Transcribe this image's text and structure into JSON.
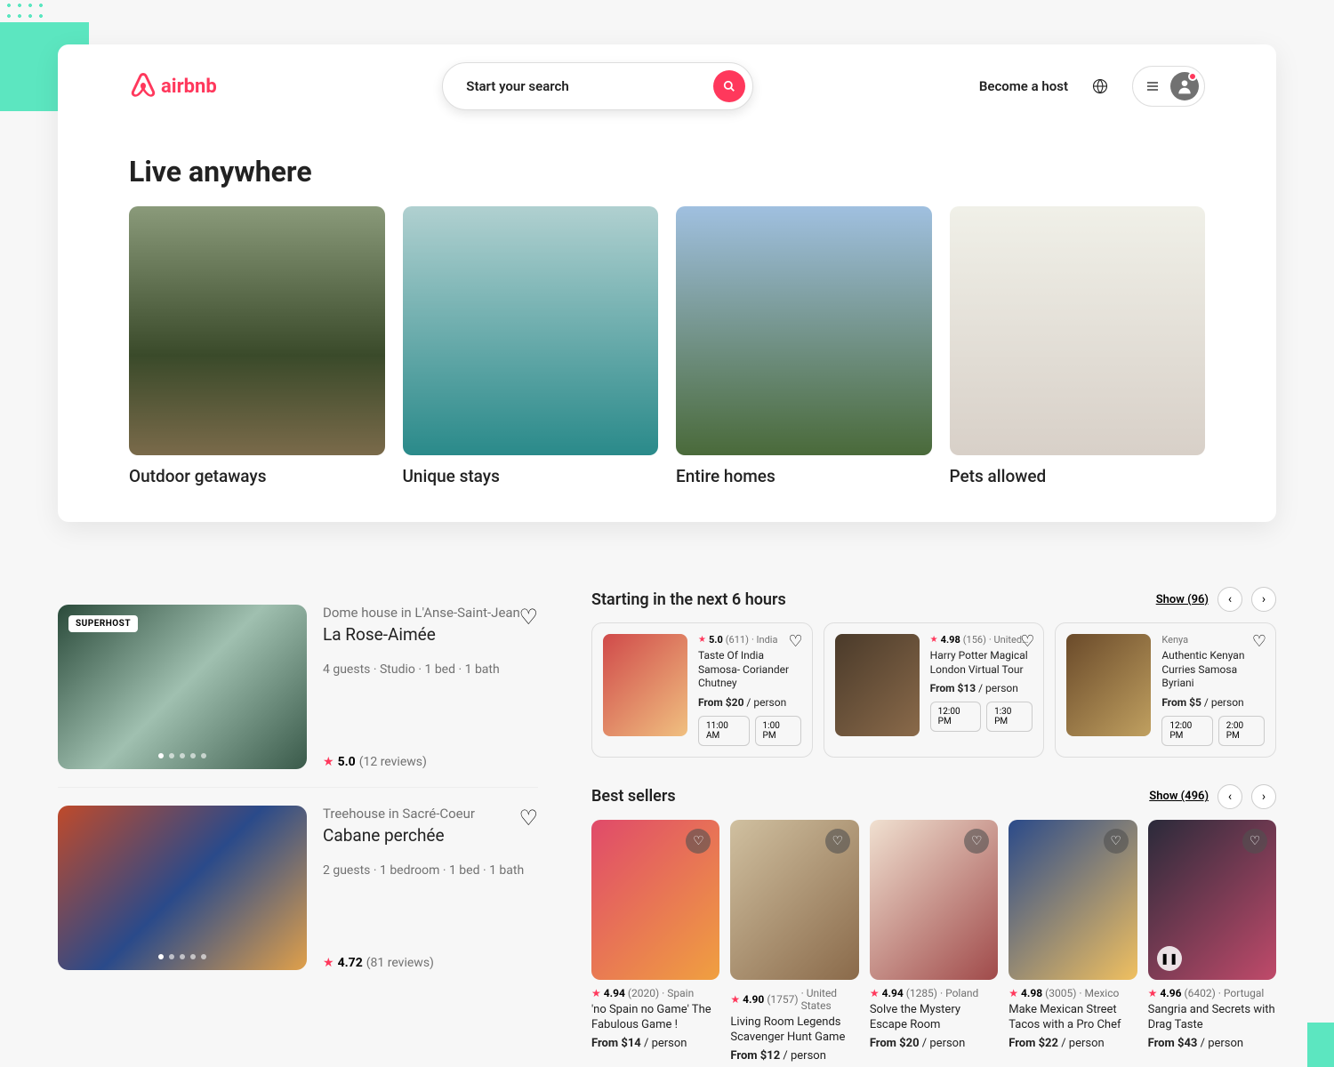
{
  "header": {
    "brand": "airbnb",
    "search_placeholder": "Start your search",
    "host_link": "Become a host"
  },
  "live_anywhere": {
    "title": "Live anywhere",
    "cards": [
      {
        "label": "Outdoor getaways"
      },
      {
        "label": "Unique stays"
      },
      {
        "label": "Entire homes"
      },
      {
        "label": "Pets allowed"
      }
    ]
  },
  "stays": [
    {
      "badge": "SUPERHOST",
      "subtitle": "Dome house in L'Anse-Saint-Jean",
      "title": "La Rose-Aimée",
      "meta": "4 guests · Studio · 1 bed · 1 bath",
      "rating": "5.0",
      "reviews": "(12 reviews)"
    },
    {
      "subtitle": "Treehouse in Sacré-Coeur",
      "title": "Cabane perchée",
      "meta": "2 guests · 1 bedroom · 1 bed · 1 bath",
      "rating": "4.72",
      "reviews": "(81 reviews)"
    }
  ],
  "starting": {
    "heading": "Starting in the next 6 hours",
    "show": "Show (96)",
    "items": [
      {
        "rating": "5.0",
        "count": "(611)",
        "loc": "· India",
        "title": "Taste Of India Samosa- Coriander Chutney",
        "price": "From $20",
        "per": " / person",
        "times": [
          "11:00 AM",
          "1:00 PM"
        ]
      },
      {
        "rating": "4.98",
        "count": "(156)",
        "loc": "· United…",
        "title": "Harry Potter Magical London Virtual Tour",
        "price": "From $13",
        "per": " / person",
        "times": [
          "12:00 PM",
          "1:30 PM"
        ]
      },
      {
        "rating": "",
        "count": "",
        "loc": "Kenya",
        "title": "Authentic Kenyan Curries Samosa Byriani",
        "price": "From $5",
        "per": " / person",
        "times": [
          "12:00 PM",
          "2:00 PM"
        ]
      }
    ]
  },
  "bestsellers": {
    "heading": "Best sellers",
    "show": "Show (496)",
    "items": [
      {
        "rating": "4.94",
        "count": "(2020)",
        "loc": "· Spain",
        "title": "'no Spain no Game' The Fabulous Game !",
        "price": "From $14",
        "per": " / person"
      },
      {
        "rating": "4.90",
        "count": "(1757)",
        "loc": "· United States",
        "title": "Living Room Legends Scavenger Hunt Game",
        "price": "From $12",
        "per": " / person"
      },
      {
        "rating": "4.94",
        "count": "(1285)",
        "loc": "· Poland",
        "title": "Solve the Mystery Escape Room",
        "price": "From $20",
        "per": " / person"
      },
      {
        "rating": "4.98",
        "count": "(3005)",
        "loc": "· Mexico",
        "title": "Make Mexican Street Tacos with a Pro Chef",
        "price": "From $22",
        "per": " / person"
      },
      {
        "rating": "4.96",
        "count": "(6402)",
        "loc": "· Portugal",
        "title": "Sangria and Secrets with Drag Taste",
        "price": "From $43",
        "per": " / person"
      }
    ]
  }
}
